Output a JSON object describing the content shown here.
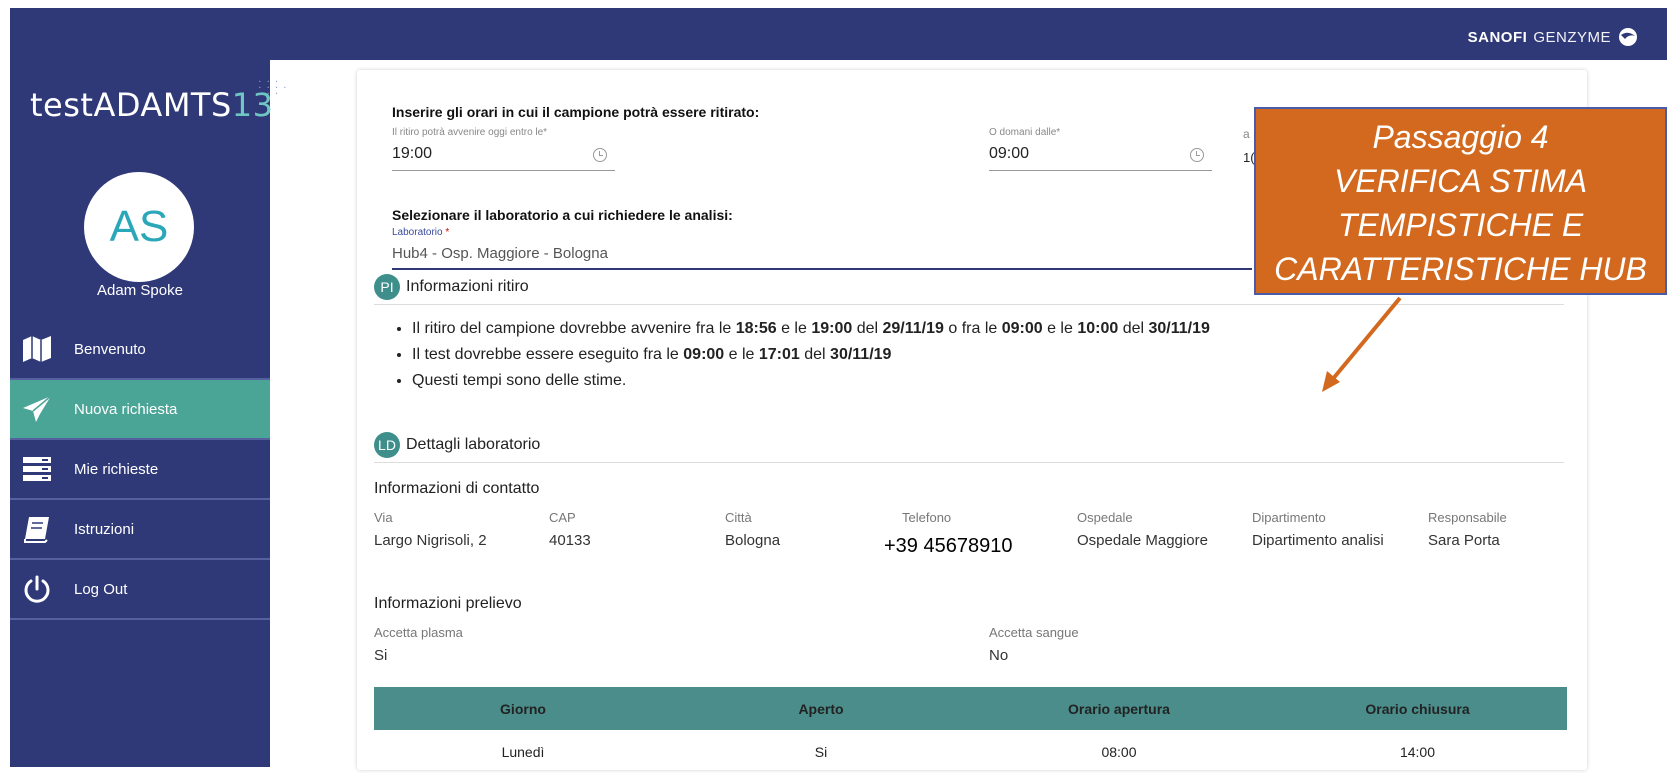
{
  "brand": {
    "bold": "SANOFI",
    "thin": "GENZYME"
  },
  "sidebar": {
    "logo_text": "testADAMTS",
    "logo_num": "13",
    "avatar_initials": "AS",
    "username": "Adam Spoke",
    "items": [
      {
        "label": "Benvenuto",
        "icon": "map-icon"
      },
      {
        "label": "Nuova richiesta",
        "icon": "paper-plane-icon",
        "active": true
      },
      {
        "label": "Mie richieste",
        "icon": "list-icon"
      },
      {
        "label": "Istruzioni",
        "icon": "book-icon"
      },
      {
        "label": "Log Out",
        "icon": "power-icon"
      }
    ]
  },
  "pickup": {
    "title": "Inserire gli orari in cui il campione potrà essere ritirato:",
    "today_label": "Il ritiro potrà avvenire oggi entro le*",
    "today_value": "19:00",
    "tomorrow_label": "O domani dalle*",
    "tomorrow_value": "09:00",
    "third_label_partial": "a",
    "third_value_partial": "1("
  },
  "lab_select": {
    "title": "Selezionare il laboratorio a cui richiedere le analisi:",
    "label": "Laboratorio",
    "req": "*",
    "value": "Hub4 - Osp. Maggiore - Bologna"
  },
  "info_ritiro": {
    "badge": "PI",
    "title": "Informazioni ritiro",
    "b1": {
      "t1": "Il ritiro del campione dovrebbe avvenire fra le ",
      "v1": "18:56",
      "t2": " e le ",
      "v2": "19:00",
      "t3": " del ",
      "v3": "29/11/19",
      "t4": " o  fra le ",
      "v4": "09:00",
      "t5": " e le ",
      "v5": "10:00",
      "t6": " del ",
      "v6": "30/11/19"
    },
    "b2": {
      "t1": "Il test dovrebbe essere eseguito fra le ",
      "v1": "09:00",
      "t2": " e le ",
      "v2": "17:01",
      "t3": " del ",
      "v3": "30/11/19"
    },
    "b3": "Questi tempi sono delle stime."
  },
  "dettagli": {
    "badge": "LD",
    "title": "Dettagli laboratorio",
    "contact_title": "Informazioni di contatto",
    "contact": [
      {
        "label": "Via",
        "value": "Largo Nigrisoli, 2"
      },
      {
        "label": "CAP",
        "value": "40133"
      },
      {
        "label": "Città",
        "value": "Bologna"
      },
      {
        "label": "Telefono",
        "value": "+39 45678910"
      },
      {
        "label": "Ospedale",
        "value": "Ospedale Maggiore"
      },
      {
        "label": "Dipartimento",
        "value": "Dipartimento analisi"
      },
      {
        "label": "Responsabile",
        "value": "Sara Porta"
      }
    ],
    "prelievo_title": "Informazioni prelievo",
    "plasma_label": "Accetta plasma",
    "plasma_value": "Si",
    "sangue_label": "Accetta sangue",
    "sangue_value": "No"
  },
  "table": {
    "headers": [
      "Giorno",
      "Aperto",
      "Orario apertura",
      "Orario chiusura"
    ],
    "rows": [
      [
        "Lunedì",
        "Si",
        "08:00",
        "14:00"
      ]
    ]
  },
  "callout": {
    "line1": "Passaggio 4",
    "line2": "VERIFICA STIMA",
    "line3": "TEMPISTICHE E",
    "line4": "CARATTERISTICHE HUB"
  },
  "colors": {
    "navy": "#2f3978",
    "teal": "#4aa597",
    "callout": "#d2691e",
    "header": "#4a8d8a"
  }
}
